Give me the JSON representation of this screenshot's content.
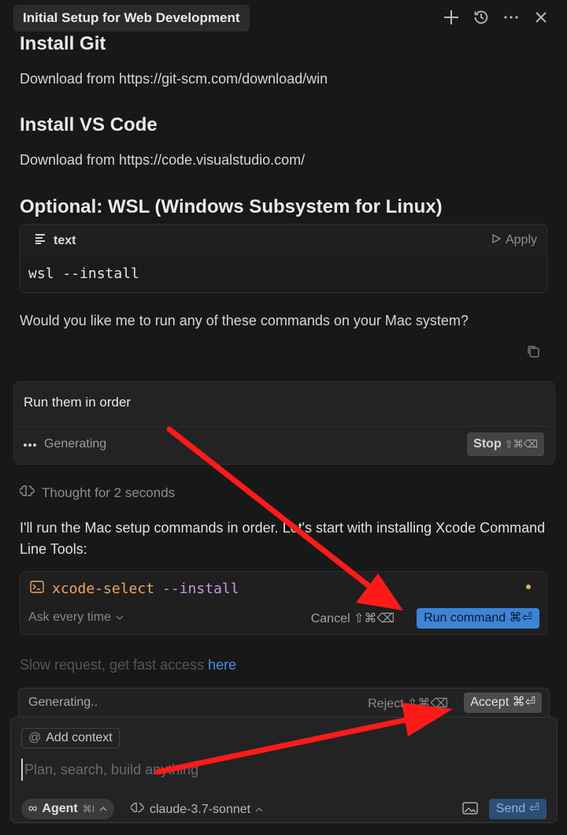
{
  "header": {
    "title": "Initial Setup for Web Development",
    "icons": [
      "plus-icon",
      "history-icon",
      "more-icon",
      "close-icon"
    ]
  },
  "content": {
    "git_heading": "Install Git",
    "git_text": "Download from https://git-scm.com/download/win",
    "vscode_heading": "Install VS Code",
    "vscode_text": "Download from https://code.visualstudio.com/",
    "wsl_heading": "Optional: WSL (Windows Subsystem for Linux)",
    "codeblock": {
      "lang": "text",
      "apply": "Apply",
      "code": "wsl --install"
    },
    "question": "Would you like me to run any of these commands on your Mac system?"
  },
  "prompt_card": {
    "text": "Run them in order",
    "status": "Generating",
    "stop_label": "Stop",
    "stop_keys": "⇧⌘⌫"
  },
  "thought": "Thought for 2 seconds",
  "reply": "I'll run the Mac setup commands in order. Let's start with installing Xcode Command Line Tools:",
  "terminal": {
    "cmd_name": "xcode-select",
    "cmd_args": "--install",
    "ask_label": "Ask every time",
    "cancel_label": "Cancel ⇧⌘⌫",
    "run_label": "Run command ⌘⏎"
  },
  "slow_notice": {
    "text": "Slow request, get fast access ",
    "link": "here"
  },
  "generating_bar": {
    "status": "Generating..",
    "reject_label": "Reject ⇧⌘⌫",
    "accept_label": "Accept ⌘⏎"
  },
  "composer": {
    "add_context": "Add context",
    "placeholder": "Plan, search, build anything",
    "agent_label": "Agent",
    "agent_keys": "⌘I",
    "model": "claude-3.7-sonnet",
    "send_label": "Send ⏎"
  },
  "colors": {
    "accent": "#3d84d6",
    "annotation_arrow": "#ff1a1a"
  }
}
